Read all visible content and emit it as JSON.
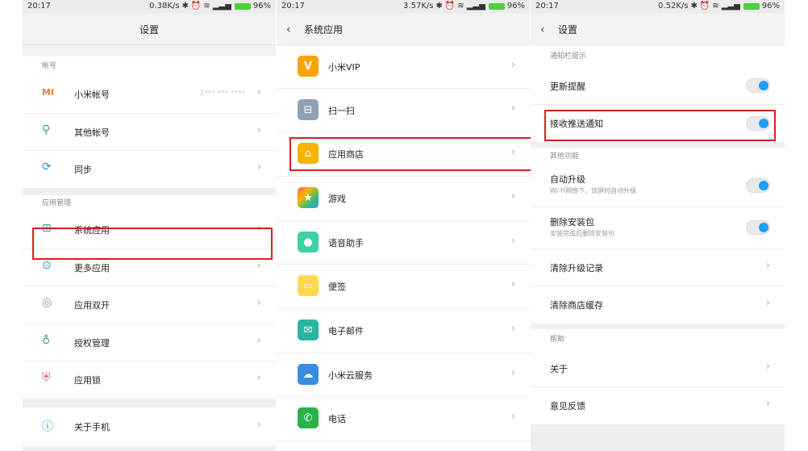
{
  "status": [
    {
      "time": "20:17",
      "speed": "0.38K/s",
      "battery": "96%"
    },
    {
      "time": "20:17",
      "speed": "3.57K/s",
      "battery": "96%"
    },
    {
      "time": "20:17",
      "speed": "0.52K/s",
      "battery": "96%"
    }
  ],
  "panel1": {
    "title": "设置",
    "section_account": "帐号",
    "mi_account": "小米帐号",
    "mi_account_value": "1*** *** ****",
    "other_accounts": "其他帐号",
    "sync": "同步",
    "section_apps": "应用管理",
    "system_apps": "系统应用",
    "more_apps": "更多应用",
    "dual_apps": "应用双开",
    "permissions": "授权管理",
    "app_lock": "应用锁",
    "about_phone": "关于手机"
  },
  "panel2": {
    "title": "系统应用",
    "items": [
      "小米VIP",
      "扫一扫",
      "应用商店",
      "游戏",
      "语音助手",
      "便签",
      "电子邮件",
      "小米云服务",
      "电话"
    ]
  },
  "panel3": {
    "title": "设置",
    "section_notify": "通知栏提示",
    "update_alert": "更新提醒",
    "update_alert_on": true,
    "receive_push": "接收推送通知",
    "receive_push_on": true,
    "section_other": "其他功能",
    "auto_upgrade": "自动升级",
    "auto_upgrade_sub": "Wi-Fi网络下，锁屏时自动升级",
    "auto_upgrade_on": true,
    "delete_pkg": "删除安装包",
    "delete_pkg_sub": "安装完成后删除安装包",
    "delete_pkg_on": true,
    "clear_records": "清除升级记录",
    "clear_cache": "清除商店缓存",
    "section_help": "帮助",
    "about": "关于",
    "feedback": "意见反馈"
  },
  "colors": {
    "highlight_box": "#d91f1f",
    "toggle_on": "#1e9dfa",
    "battery": "#4cd13d"
  }
}
